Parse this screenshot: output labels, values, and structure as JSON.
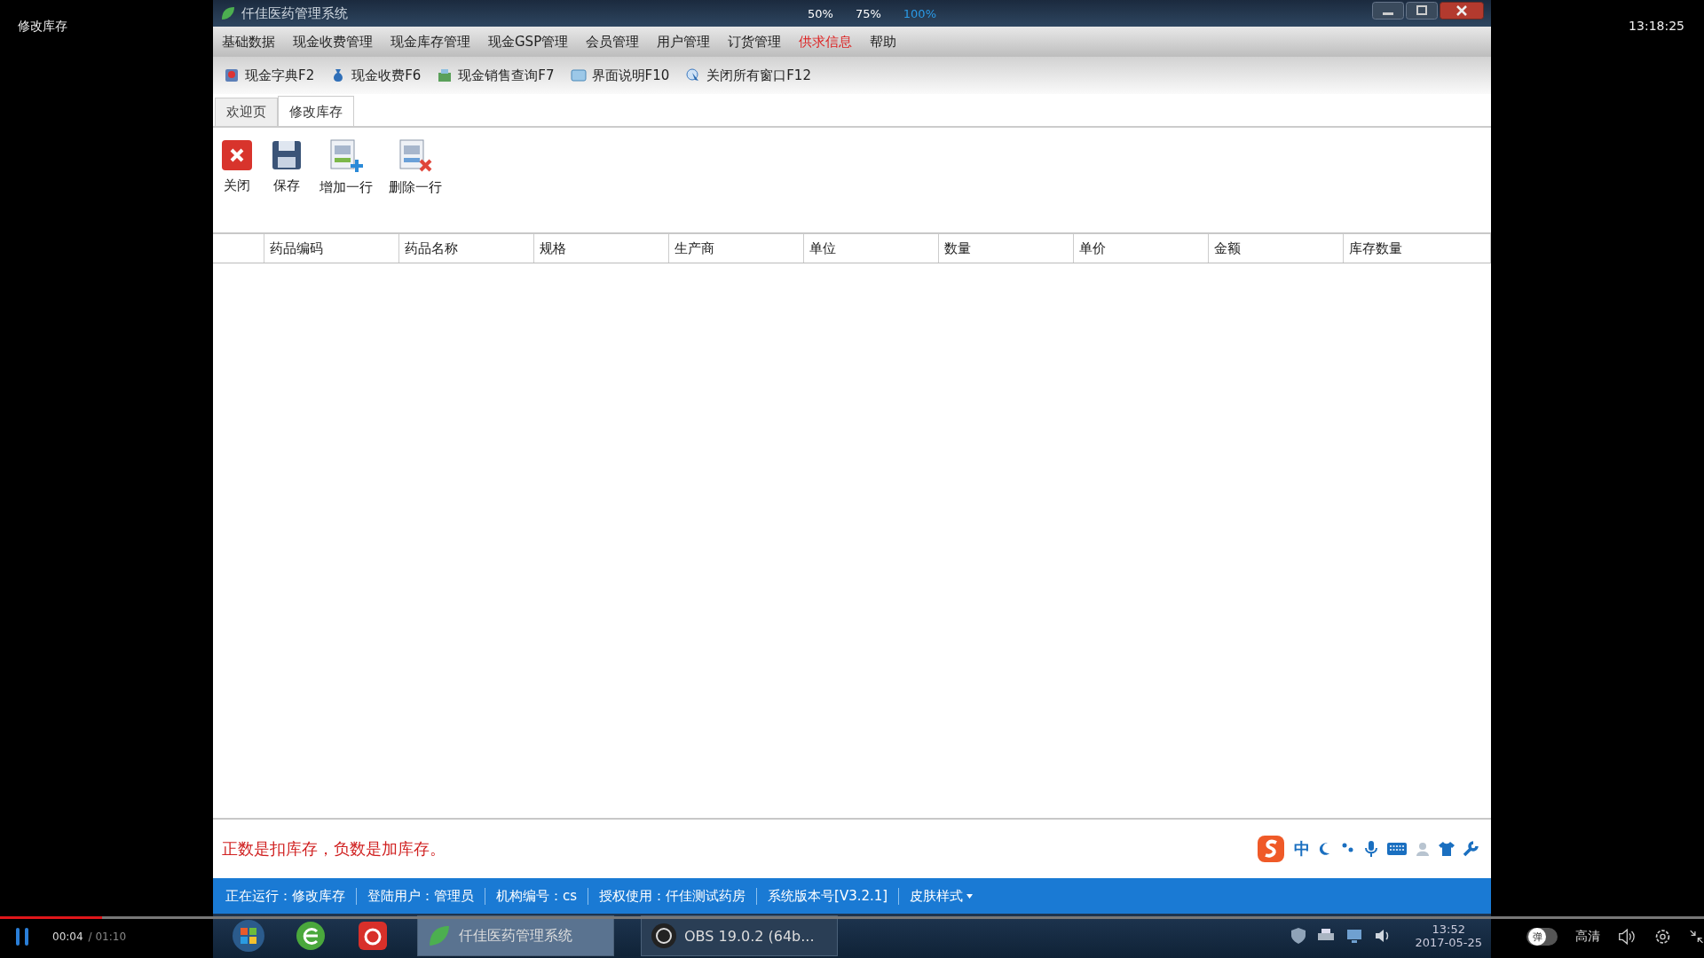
{
  "player": {
    "title": "修改库存",
    "clock": "13:18:25",
    "zoom_options": [
      {
        "label": "50%",
        "selected": false
      },
      {
        "label": "75%",
        "selected": false
      },
      {
        "label": "100%",
        "selected": true
      }
    ],
    "elapsed": "00:04",
    "duration": "/ 01:10",
    "progress": {
      "level": 0.06
    },
    "danmaku_toggle": {
      "label": "弹",
      "on": false
    },
    "quality": "高清"
  },
  "app": {
    "title": "仟佳医药管理系统",
    "menu": [
      {
        "label": "基础数据",
        "highlighted": false
      },
      {
        "label": "现金收费管理",
        "highlighted": false
      },
      {
        "label": "现金库存管理",
        "highlighted": false
      },
      {
        "label": "现金GSP管理",
        "highlighted": false
      },
      {
        "label": "会员管理",
        "highlighted": false
      },
      {
        "label": "用户管理",
        "highlighted": false
      },
      {
        "label": "订货管理",
        "highlighted": false
      },
      {
        "label": "供求信息",
        "highlighted": true
      },
      {
        "label": "帮助",
        "highlighted": false
      }
    ],
    "toolbar": [
      {
        "label": "现金字典F2",
        "kind": "book"
      },
      {
        "label": "现金收费F6",
        "kind": "moneybag"
      },
      {
        "label": "现金销售查询F7",
        "kind": "register"
      },
      {
        "label": "界面说明F10",
        "kind": "screen"
      },
      {
        "label": "关闭所有窗口F12",
        "kind": "pointer"
      }
    ],
    "tabs": [
      {
        "label": "欢迎页",
        "selected": false
      },
      {
        "label": "修改库存",
        "selected": true
      }
    ],
    "actions": [
      {
        "label": "关闭",
        "kind": "close"
      },
      {
        "label": "保存",
        "kind": "save"
      },
      {
        "label": "增加一行",
        "kind": "add-row"
      },
      {
        "label": "删除一行",
        "kind": "delete-row"
      }
    ],
    "table": {
      "columns": [
        "药品编码",
        "药品名称",
        "规格",
        "生产商",
        "单位",
        "数量",
        "单价",
        "金额",
        "库存数量"
      ]
    },
    "note": "正数是扣库存，负数是加库存。",
    "ime": {
      "mode": "中"
    },
    "status_bar": [
      "正在运行：修改库存",
      "登陆用户：管理员",
      "机构编号：cs",
      "授权使用：仟佳测试药房",
      "系统版本号[V3.2.1]"
    ],
    "skin_menu": "皮肤样式"
  },
  "taskbar": {
    "windows": [
      {
        "label": "仟佳医药管理系统",
        "selected": true
      },
      {
        "label": "OBS 19.0.2 (64b...",
        "selected": false
      }
    ],
    "time": "13:52",
    "date": "2017-05-25"
  }
}
